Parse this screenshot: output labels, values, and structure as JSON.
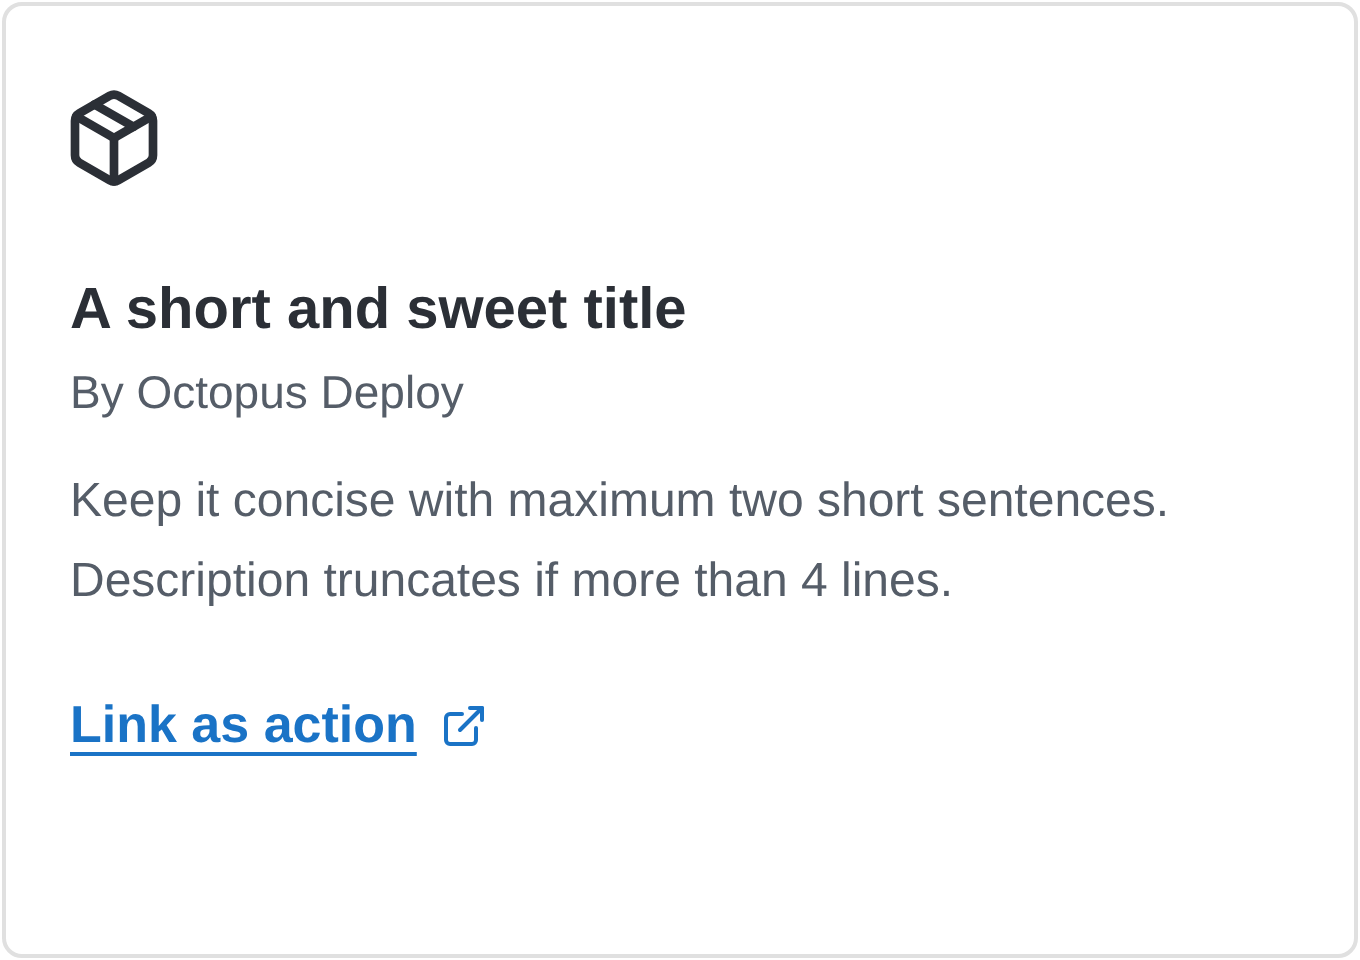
{
  "card": {
    "title": "A short and sweet title",
    "author": "By Octopus Deploy",
    "description": "Keep it concise with maximum two short sentences. Description truncates if more than 4 lines.",
    "link": "Link as action"
  }
}
